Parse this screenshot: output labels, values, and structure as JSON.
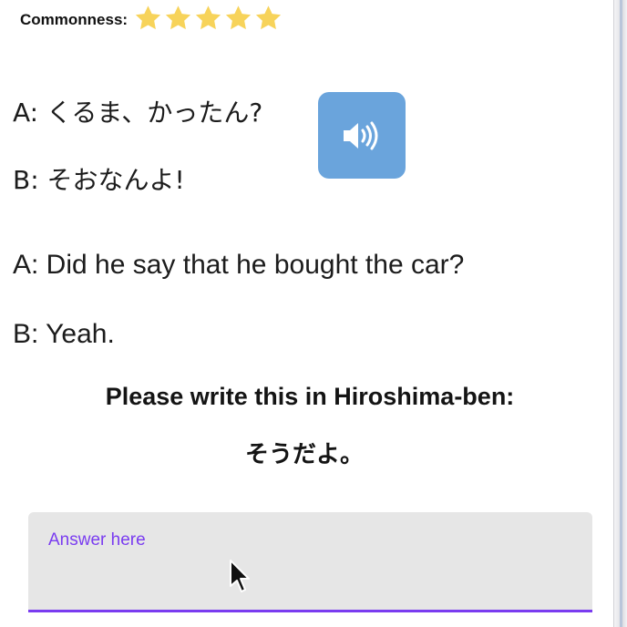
{
  "commonness": {
    "label": "Commonness:",
    "rating": 5,
    "max": 5,
    "star_icon": "star-icon",
    "star_color": "#f7d35a"
  },
  "dialogue": {
    "japanese": [
      {
        "speaker": "A",
        "text": "A: くるま、かったん?"
      },
      {
        "speaker": "B",
        "text": "B: そおなんよ!"
      }
    ],
    "english": [
      {
        "speaker": "A",
        "text": "A: Did he say that he bought the car?"
      },
      {
        "speaker": "B",
        "text": "B: Yeah."
      }
    ]
  },
  "audio_button": {
    "icon": "speaker-icon",
    "color": "#6aa4dc"
  },
  "prompt": {
    "instruction": "Please write this in Hiroshima-ben:",
    "target": "そうだよ。"
  },
  "answer": {
    "label": "Answer here",
    "value": "",
    "accent_color": "#7a3cf0"
  }
}
